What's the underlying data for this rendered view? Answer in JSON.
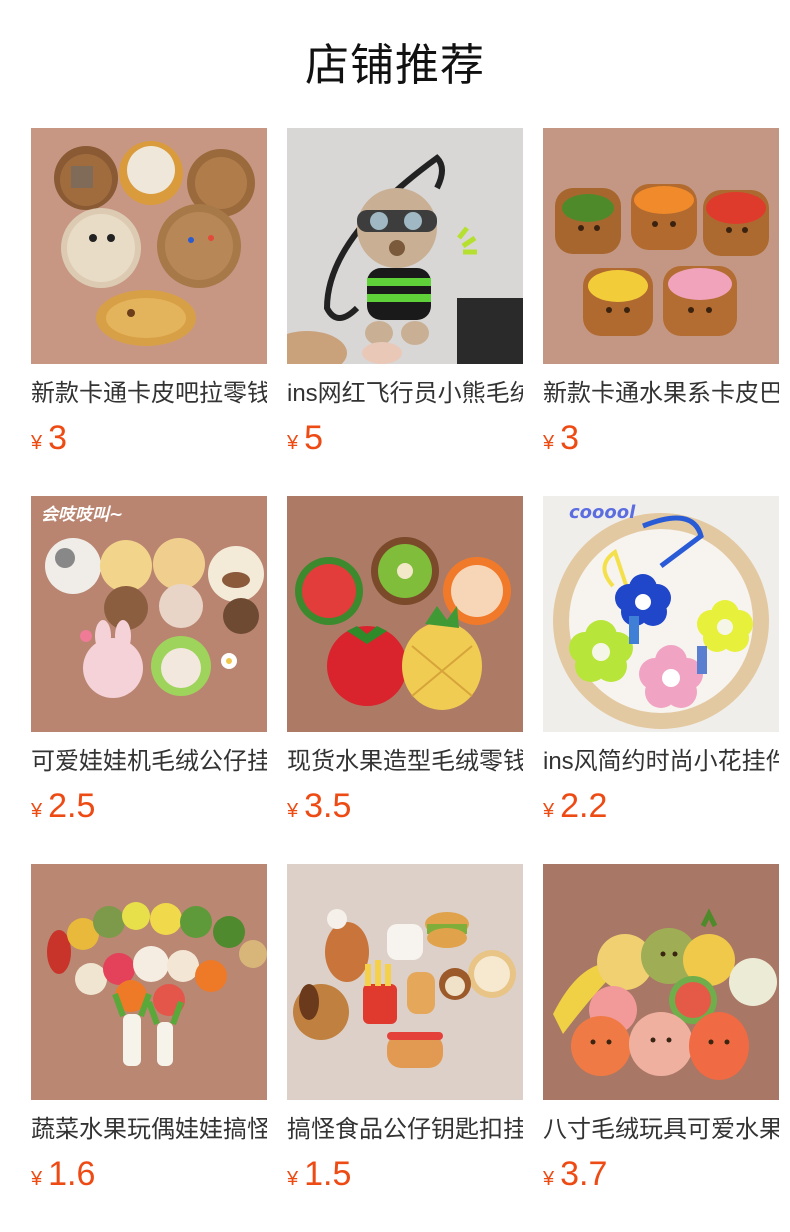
{
  "section": {
    "title": "店铺推荐"
  },
  "products": [
    {
      "name": "新款卡通卡皮吧拉零钱包",
      "currency": "¥",
      "price": "3",
      "bg": "#c79784"
    },
    {
      "name": "ins网红飞行员小熊毛绒挂件",
      "currency": "¥",
      "price": "5",
      "bg": "#d9d7d6"
    },
    {
      "name": "新款卡通水果系卡皮巴拉零钱包",
      "currency": "¥",
      "price": "3",
      "bg": "#c49784"
    },
    {
      "name": "可爱娃娃机毛绒公仔挂件",
      "currency": "¥",
      "price": "2.5",
      "bg": "#b98571",
      "image_caption": "会吱吱叫~"
    },
    {
      "name": "现货水果造型毛绒零钱包",
      "currency": "¥",
      "price": "3.5",
      "bg": "#ad7a66"
    },
    {
      "name": "ins风简约时尚小花挂件",
      "currency": "¥",
      "price": "2.2",
      "bg": "#f0eeea",
      "image_caption": "cooool"
    },
    {
      "name": "蔬菜水果玩偶娃娃搞怪挂件",
      "currency": "¥",
      "price": "1.6",
      "bg": "#b98772"
    },
    {
      "name": "搞怪食品公仔钥匙扣挂件",
      "currency": "¥",
      "price": "1.5",
      "bg": "#ddd0c8"
    },
    {
      "name": "八寸毛绒玩具可爱水果公仔",
      "currency": "¥",
      "price": "3.7",
      "bg": "#a87765"
    }
  ]
}
